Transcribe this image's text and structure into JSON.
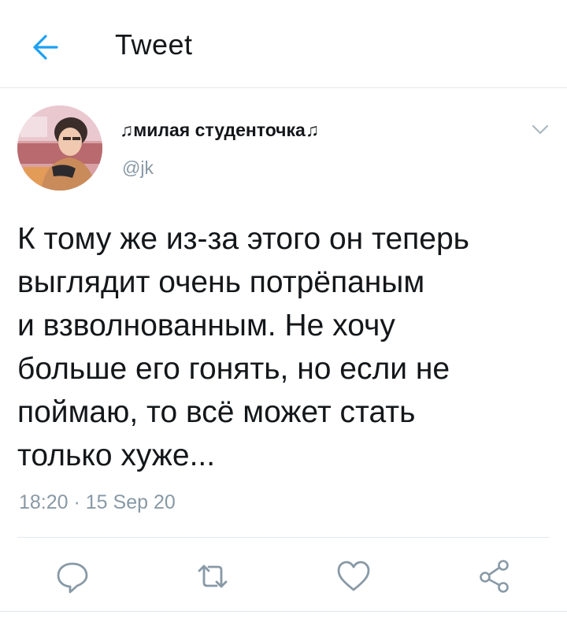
{
  "header": {
    "title": "Tweet",
    "back_icon": "arrow-left-icon"
  },
  "author": {
    "display_name": "♫милая студенточка♫",
    "handle": "@jk",
    "menu_icon": "chevron-down-icon"
  },
  "tweet": {
    "text": "К тому же из-за этого он теперь\nвыглядит очень потрёпаным\nи взволнованным. Не хочу\nбольше его гонять, но если не\nпоймаю, то всё может стать\nтолько хуже...",
    "timestamp": "18:20 · 15 Sep 20"
  },
  "actions": [
    "reply-icon",
    "retweet-icon",
    "like-icon",
    "share-icon"
  ],
  "colors": {
    "accent": "#1da1f2",
    "muted": "#8899a6",
    "text": "#14171a",
    "border": "#e1e8ed"
  }
}
